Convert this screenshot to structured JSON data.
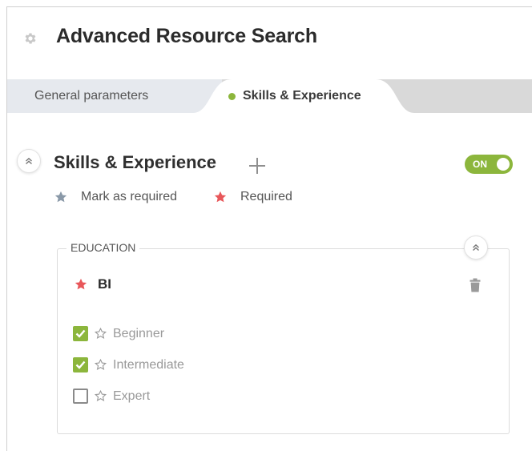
{
  "header": {
    "title": "Advanced Resource Search",
    "icon": "gear-icon"
  },
  "tabs": [
    {
      "label": "General parameters",
      "active": false
    },
    {
      "label": "Skills & Experience",
      "active": true
    }
  ],
  "section": {
    "title": "Skills & Experience",
    "toggle_label": "ON",
    "legend": {
      "mark_required": "Mark as required",
      "required": "Required"
    }
  },
  "education": {
    "label": "EDUCATION",
    "skill": "BI",
    "levels": [
      {
        "label": "Beginner",
        "checked": true
      },
      {
        "label": "Intermediate",
        "checked": true
      },
      {
        "label": "Expert",
        "checked": false
      }
    ]
  },
  "colors": {
    "accent_green": "#8cb63c",
    "required_red": "#e8575a",
    "neutral_star": "#8a99a8"
  }
}
